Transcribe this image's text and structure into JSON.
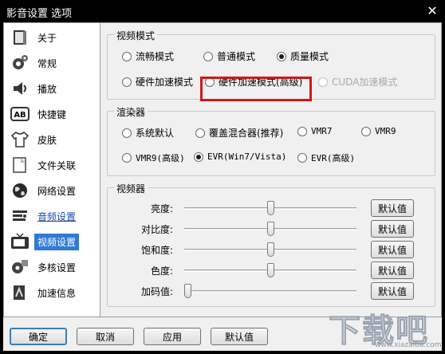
{
  "window": {
    "title": "影音设置 选项",
    "close_glyph": "✕"
  },
  "sidebar": {
    "items": [
      {
        "label": "关于",
        "icon": "book-icon"
      },
      {
        "label": "常规",
        "icon": "gear-icon"
      },
      {
        "label": "播放",
        "icon": "speaker-icon"
      },
      {
        "label": "快捷键",
        "icon": "keyboard-icon"
      },
      {
        "label": "皮肤",
        "icon": "shirt-icon"
      },
      {
        "label": "文件关联",
        "icon": "folder-icon"
      },
      {
        "label": "网络设置",
        "icon": "globe-icon"
      },
      {
        "label": "音频设置",
        "icon": "audio-icon"
      },
      {
        "label": "视频设置",
        "icon": "tv-icon"
      },
      {
        "label": "多核设置",
        "icon": "cpu-icon"
      },
      {
        "label": "加速信息",
        "icon": "accelerate-icon"
      }
    ],
    "hover_index": 7,
    "selected_index": 8
  },
  "video_mode": {
    "legend": "视频模式",
    "options": [
      {
        "label": "流畅模式",
        "checked": false,
        "disabled": false
      },
      {
        "label": "普通模式",
        "checked": false,
        "disabled": false
      },
      {
        "label": "质量模式",
        "checked": true,
        "disabled": false
      },
      {
        "label": "硬件加速模式",
        "checked": false,
        "disabled": false
      },
      {
        "label": "硬件加速模式(高级)",
        "checked": false,
        "disabled": false
      },
      {
        "label": "CUDA加速模式",
        "checked": false,
        "disabled": true
      }
    ]
  },
  "renderer": {
    "legend": "渲染器",
    "options": [
      {
        "label": "系统默认",
        "checked": false
      },
      {
        "label": "覆盖混合器(推荐)",
        "checked": false
      },
      {
        "label": "VMR7",
        "checked": false
      },
      {
        "label": "VMR9",
        "checked": false
      },
      {
        "label": "VMR9(高级)",
        "checked": false
      },
      {
        "label": "EVR(Win7/Vista)",
        "checked": true
      },
      {
        "label": "EVR(高级)",
        "checked": false
      }
    ]
  },
  "adjust": {
    "legend": "视频器",
    "default_label": "默认值",
    "sliders": [
      {
        "label": "亮度:",
        "value": 0.5
      },
      {
        "label": "对比度:",
        "value": 0.5
      },
      {
        "label": "饱和度:",
        "value": 0.5
      },
      {
        "label": "色度:",
        "value": 0.5
      },
      {
        "label": "加码值:",
        "value": 0.0
      }
    ]
  },
  "buttons": {
    "ok": "确定",
    "cancel": "取消",
    "apply": "应用",
    "default": "默认值"
  },
  "watermark": {
    "big": "下载吧",
    "small": "www.xiazaiba.com"
  },
  "colors": {
    "accent": "#2f7ad6",
    "highlight_border": "#d0181a",
    "titlebar": "#000000"
  }
}
